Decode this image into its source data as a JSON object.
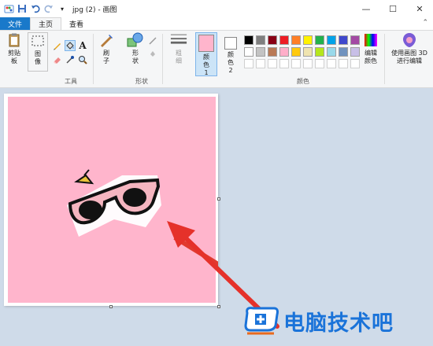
{
  "window": {
    "title": "jpg (2) - 画图",
    "controls": [
      "minimize-icon",
      "maximize-icon",
      "close-icon"
    ]
  },
  "quick_access": [
    "paint-app-icon",
    "save-icon",
    "undo-icon",
    "redo-icon",
    "customize-icon"
  ],
  "tabs": [
    {
      "label": "文件"
    },
    {
      "label": "主页"
    },
    {
      "label": "查看"
    }
  ],
  "ribbon": {
    "clipboard": {
      "label": "剪贴板"
    },
    "image": {
      "label": "图像"
    },
    "tools_group": "工具",
    "brush": {
      "label": "刷子"
    },
    "shapes": {
      "label": "形状"
    },
    "shapes_group": "形状",
    "size": {
      "label": "粗细"
    },
    "color1": {
      "label": "颜色 1",
      "color": "#ffb5cc"
    },
    "color2": {
      "label": "颜色 2",
      "color": "#ffffff"
    },
    "colors_group": "颜色",
    "edit_colors": {
      "label": "编辑颜色"
    },
    "paint3d": {
      "label": "使用画图 3D 进行编辑"
    },
    "palette_row1": [
      "#000000",
      "#7f7f7f",
      "#880015",
      "#ed1c24",
      "#ff7f27",
      "#fff200",
      "#22b14c",
      "#00a2e8",
      "#3f48cc",
      "#a349a4"
    ],
    "palette_row2": [
      "#ffffff",
      "#c3c3c3",
      "#b97a57",
      "#ffaec9",
      "#ffc90e",
      "#efe4b0",
      "#b5e61d",
      "#99d9ea",
      "#7092be",
      "#c8bfe7"
    ]
  },
  "canvas": {
    "background": "#ffb5cc"
  },
  "watermark": {
    "text": "电脑技术吧"
  }
}
